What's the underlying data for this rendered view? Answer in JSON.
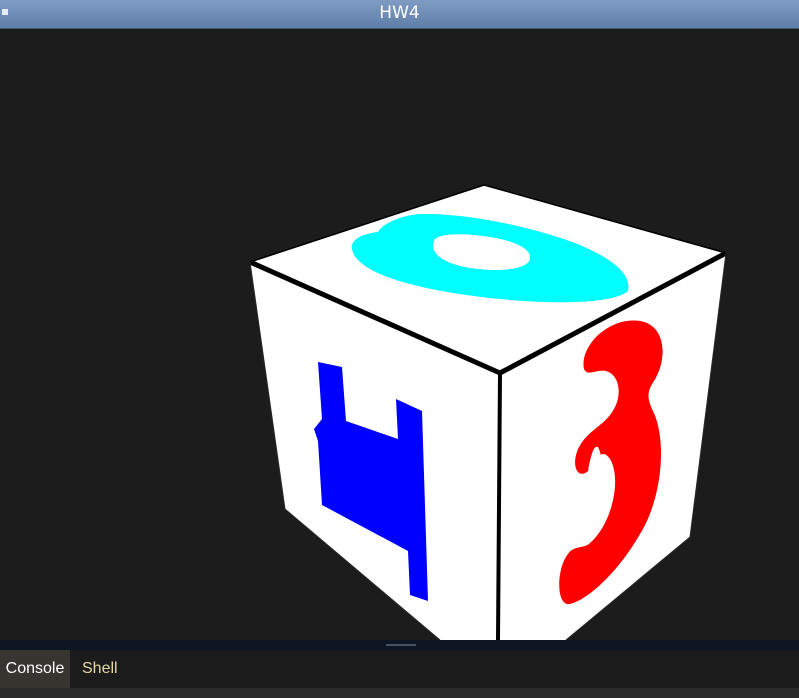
{
  "window": {
    "title": "HW4"
  },
  "scene": {
    "background_color": "#1c1c1c",
    "cube": {
      "face_color": "#ffffff",
      "edge_color": "#000000",
      "faces": [
        {
          "name": "top",
          "digit": "6",
          "color": "#00ffff"
        },
        {
          "name": "front-left",
          "digit": "4",
          "color": "#0000ff"
        },
        {
          "name": "front-right",
          "digit": "3",
          "color": "#ff0000"
        }
      ]
    }
  },
  "bottom_panel": {
    "tabs": [
      {
        "label": "Console",
        "active": true
      },
      {
        "label": "Shell",
        "active": false
      }
    ]
  },
  "colors": {
    "titlebar": "#6f8db6",
    "tab_active_bg": "#36352f",
    "tab_inactive_text": "#e7d7a8"
  }
}
